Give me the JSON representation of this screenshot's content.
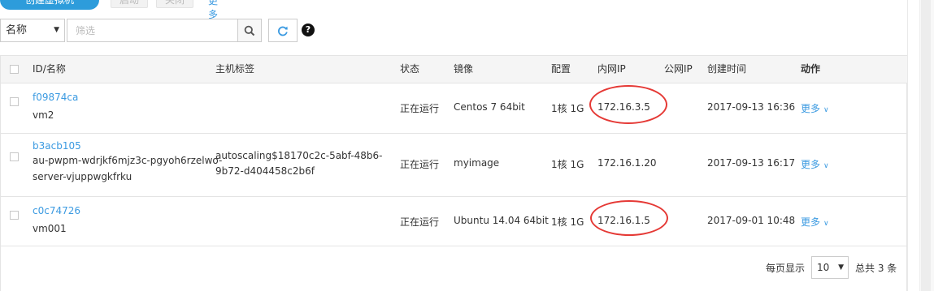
{
  "toolbar": {
    "create_label": "创建虚拟机",
    "start_label": "启动",
    "stop_label": "关闭",
    "more_label": "更多"
  },
  "filter": {
    "field_value": "名称",
    "placeholder": "筛选"
  },
  "table": {
    "headers": {
      "id_name": "ID/名称",
      "host_tag": "主机标签",
      "status": "状态",
      "image": "镜像",
      "config": "配置",
      "private_ip": "内网IP",
      "public_ip": "公网IP",
      "created": "创建时间",
      "actions": "动作"
    },
    "rows": [
      {
        "id": "f09874ca",
        "name": "vm2",
        "name_line2": "",
        "tag_line1": "",
        "tag_line2": "",
        "status": "正在运行",
        "image": "Centos 7 64bit",
        "config": "1核 1G",
        "private_ip": "172.16.3.5",
        "public_ip": "",
        "created": "2017-09-13 16:36",
        "action": "更多",
        "highlighted": true
      },
      {
        "id": "b3acb105",
        "name": "au-pwpm-wdrjkf6mjz3c-pgyoh6rzelwo-",
        "name_line2": "server-vjuppwgkfrku",
        "tag_line1": "autoscaling$18170c2c-5abf-48b6-",
        "tag_line2": "9b72-d404458c2b6f",
        "status": "正在运行",
        "image": "myimage",
        "config": "1核 1G",
        "private_ip": "172.16.1.20",
        "public_ip": "",
        "created": "2017-09-13 16:17",
        "action": "更多",
        "highlighted": false
      },
      {
        "id": "c0c74726",
        "name": "vm001",
        "name_line2": "",
        "tag_line1": "",
        "tag_line2": "",
        "status": "正在运行",
        "image": "Ubuntu 14.04 64bit",
        "config": "1核 1G",
        "private_ip": "172.16.1.5",
        "public_ip": "",
        "created": "2017-09-01 10:48",
        "action": "更多",
        "highlighted": true
      }
    ]
  },
  "pagination": {
    "per_page_label": "每页显示",
    "per_page_value": "10",
    "total_label": "总共 3 条"
  },
  "colors": {
    "accent": "#2d9cdb",
    "link": "#3b9ae1",
    "annotation": "#e53935"
  }
}
